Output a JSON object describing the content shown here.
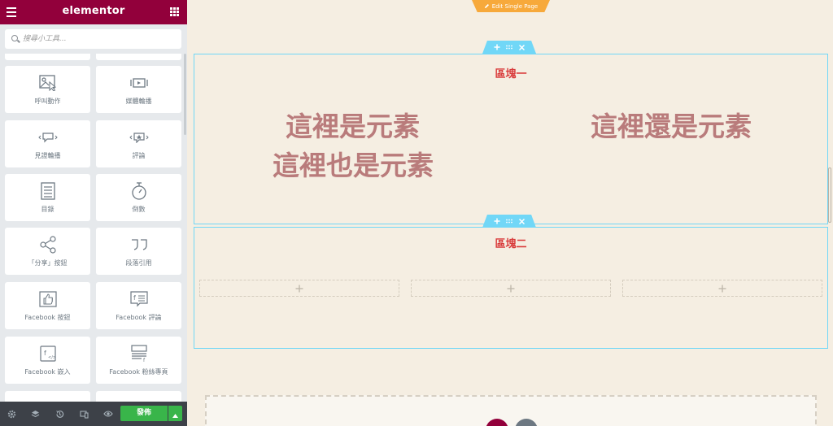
{
  "panel": {
    "logo": "elementor",
    "search_placeholder": "搜尋小工具...",
    "widgets": [
      {
        "label": "呼叫動作",
        "icon": "call-to-action-icon"
      },
      {
        "label": "媒體輪播",
        "icon": "media-carousel-icon"
      },
      {
        "label": "見證輪播",
        "icon": "testimonial-carousel-icon"
      },
      {
        "label": "評論",
        "icon": "reviews-icon"
      },
      {
        "label": "目錄",
        "icon": "table-of-contents-icon"
      },
      {
        "label": "倒數",
        "icon": "countdown-icon"
      },
      {
        "label": "「分享」按鈕",
        "icon": "share-icon"
      },
      {
        "label": "段落引用",
        "icon": "blockquote-icon"
      },
      {
        "label": "Facebook 按鈕",
        "icon": "facebook-like-icon"
      },
      {
        "label": "Facebook 評論",
        "icon": "facebook-comments-icon"
      },
      {
        "label": "Facebook 嵌入",
        "icon": "facebook-embed-icon"
      },
      {
        "label": "Facebook 粉絲專頁",
        "icon": "facebook-page-icon"
      }
    ],
    "footer": {
      "publish_label": "發佈"
    }
  },
  "canvas": {
    "edit_tab_label": "Edit Single Page",
    "section1": {
      "title": "區塊一",
      "left_text_1": "這裡是元素",
      "left_text_2": "這裡也是元素",
      "right_text": "這裡還是元素"
    },
    "section2": {
      "title": "區塊二",
      "empty_columns": 3
    }
  },
  "colors": {
    "brand": "#92003b",
    "accent_blue": "#71d7f7",
    "publish_green": "#39b54a",
    "edit_tab_orange": "#f7a93b",
    "section_title_red": "#d93b3b",
    "element_text": "#b97b7b",
    "canvas_bg": "#f5eee2"
  }
}
